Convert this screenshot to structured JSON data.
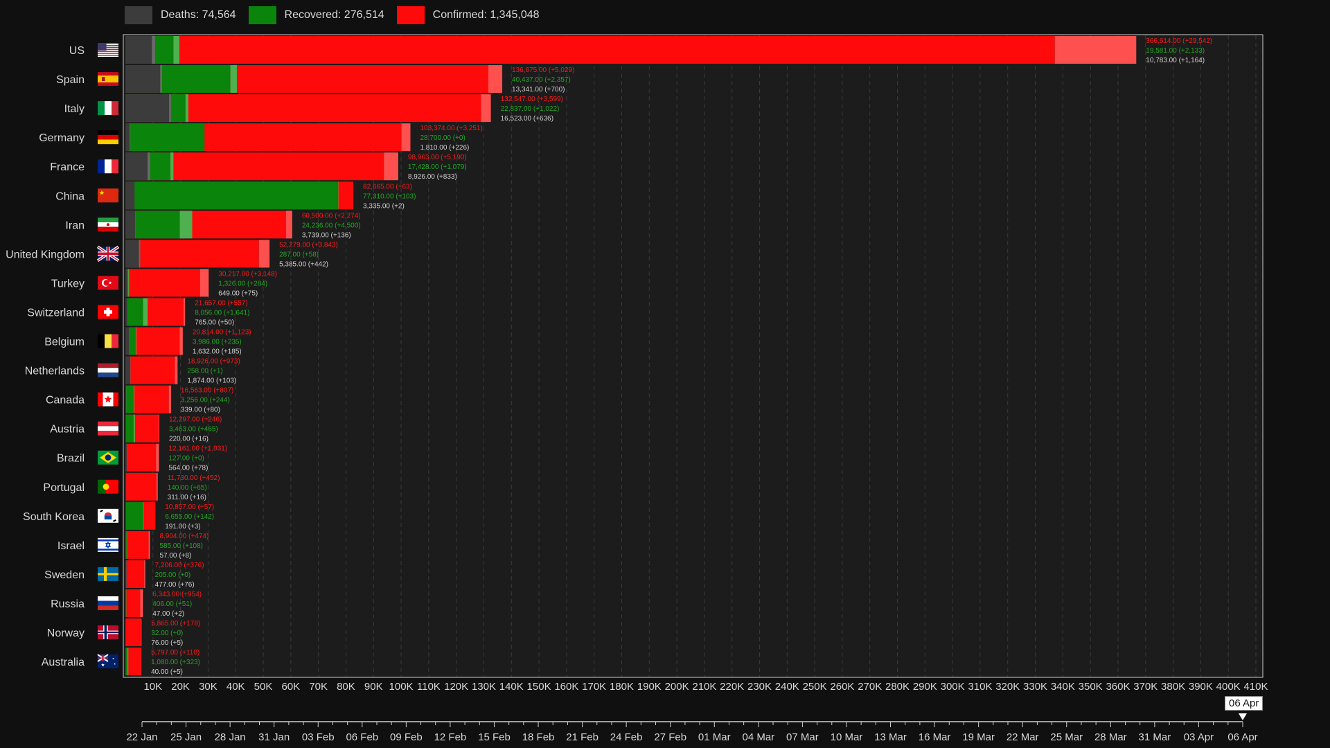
{
  "legend": {
    "deaths_label": "Deaths: 74,564",
    "recovered_label": "Recovered: 276,514",
    "confirmed_label": "Confirmed: 1,345,048"
  },
  "colors": {
    "background": "#101010",
    "deaths": "#3c3c3c",
    "recovered": "#0b840b",
    "confirmed": "#ff0a0a",
    "increment": "#ff5050",
    "plot_bg": "#1c1c1c",
    "text": "#d8d8d8"
  },
  "timeline": {
    "labels": [
      "22 Jan",
      "25 Jan",
      "28 Jan",
      "31 Jan",
      "03 Feb",
      "06 Feb",
      "09 Feb",
      "12 Feb",
      "15 Feb",
      "18 Feb",
      "21 Feb",
      "24 Feb",
      "27 Feb",
      "01 Mar",
      "04 Mar",
      "07 Mar",
      "10 Mar",
      "13 Mar",
      "16 Mar",
      "19 Mar",
      "22 Mar",
      "25 Mar",
      "28 Mar",
      "31 Mar",
      "03 Apr",
      "06 Apr"
    ],
    "current": "06 Apr"
  },
  "chart_data": {
    "type": "bar",
    "orientation": "horizontal",
    "stacked": "overlay",
    "xlim": [
      0,
      410000
    ],
    "x_ticks": [
      "10K",
      "20K",
      "30K",
      "40K",
      "50K",
      "60K",
      "70K",
      "80K",
      "90K",
      "100K",
      "110K",
      "120K",
      "130K",
      "140K",
      "150K",
      "160K",
      "170K",
      "180K",
      "190K",
      "200K",
      "210K",
      "220K",
      "230K",
      "240K",
      "250K",
      "260K",
      "270K",
      "280K",
      "290K",
      "300K",
      "310K",
      "320K",
      "330K",
      "340K",
      "350K",
      "360K",
      "370K",
      "380K",
      "390K",
      "400K",
      "410K"
    ],
    "grid": true,
    "legend_position": "top-left",
    "rows": [
      {
        "country": "US",
        "flag": "us",
        "confirmed": 366614,
        "confirmed_inc": 29542,
        "recovered": 19581,
        "recovered_inc": 2133,
        "deaths": 10783,
        "deaths_inc": 1164,
        "confirmed_label": "366,614.00 (+29,542)",
        "recovered_label": "19,581.00 (+2,133)",
        "deaths_label": "10,783.00 (+1,164)"
      },
      {
        "country": "Spain",
        "flag": "es",
        "confirmed": 136675,
        "confirmed_inc": 5029,
        "recovered": 40437,
        "recovered_inc": 2357,
        "deaths": 13341,
        "deaths_inc": 700,
        "confirmed_label": "136,675.00 (+5,029)",
        "recovered_label": "40,437.00 (+2,357)",
        "deaths_label": "13,341.00 (+700)"
      },
      {
        "country": "Italy",
        "flag": "it",
        "confirmed": 132547,
        "confirmed_inc": 3599,
        "recovered": 22837,
        "recovered_inc": 1022,
        "deaths": 16523,
        "deaths_inc": 636,
        "confirmed_label": "132,547.00 (+3,599)",
        "recovered_label": "22,837.00 (+1,022)",
        "deaths_label": "16,523.00 (+636)"
      },
      {
        "country": "Germany",
        "flag": "de",
        "confirmed": 103374,
        "confirmed_inc": 3251,
        "recovered": 28700,
        "recovered_inc": 0,
        "deaths": 1810,
        "deaths_inc": 226,
        "confirmed_label": "103,374.00 (+3,251)",
        "recovered_label": "28,700.00 (+0)",
        "deaths_label": "1,810.00 (+226)"
      },
      {
        "country": "France",
        "flag": "fr",
        "confirmed": 98963,
        "confirmed_inc": 5190,
        "recovered": 17428,
        "recovered_inc": 1079,
        "deaths": 8926,
        "deaths_inc": 833,
        "confirmed_label": "98,963.00 (+5,190)",
        "recovered_label": "17,428.00 (+1,079)",
        "deaths_label": "8,926.00 (+833)"
      },
      {
        "country": "China",
        "flag": "cn",
        "confirmed": 82665,
        "confirmed_inc": 63,
        "recovered": 77310,
        "recovered_inc": 103,
        "deaths": 3335,
        "deaths_inc": 2,
        "confirmed_label": "82,665.00 (+63)",
        "recovered_label": "77,310.00 (+103)",
        "deaths_label": "3,335.00 (+2)"
      },
      {
        "country": "Iran",
        "flag": "ir",
        "confirmed": 60500,
        "confirmed_inc": 2274,
        "recovered": 24236,
        "recovered_inc": 4500,
        "deaths": 3739,
        "deaths_inc": 136,
        "confirmed_label": "60,500.00 (+2,274)",
        "recovered_label": "24,236.00 (+4,500)",
        "deaths_label": "3,739.00 (+136)"
      },
      {
        "country": "United Kingdom",
        "flag": "gb",
        "confirmed": 52279,
        "confirmed_inc": 3843,
        "recovered": 287,
        "recovered_inc": 58,
        "deaths": 5385,
        "deaths_inc": 442,
        "confirmed_label": "52,279.00 (+3,843)",
        "recovered_label": "287.00 (+58)",
        "deaths_label": "5,385.00 (+442)"
      },
      {
        "country": "Turkey",
        "flag": "tr",
        "confirmed": 30217,
        "confirmed_inc": 3148,
        "recovered": 1326,
        "recovered_inc": 284,
        "deaths": 649,
        "deaths_inc": 75,
        "confirmed_label": "30,217.00 (+3,148)",
        "recovered_label": "1,326.00 (+284)",
        "deaths_label": "649.00 (+75)"
      },
      {
        "country": "Switzerland",
        "flag": "ch",
        "confirmed": 21657,
        "confirmed_inc": 557,
        "recovered": 8056,
        "recovered_inc": 1641,
        "deaths": 765,
        "deaths_inc": 50,
        "confirmed_label": "21,657.00 (+557)",
        "recovered_label": "8,056.00 (+1,641)",
        "deaths_label": "765.00 (+50)"
      },
      {
        "country": "Belgium",
        "flag": "be",
        "confirmed": 20814,
        "confirmed_inc": 1123,
        "recovered": 3986,
        "recovered_inc": 235,
        "deaths": 1632,
        "deaths_inc": 185,
        "confirmed_label": "20,814.00 (+1,123)",
        "recovered_label": "3,986.00 (+235)",
        "deaths_label": "1,632.00 (+185)"
      },
      {
        "country": "Netherlands",
        "flag": "nl",
        "confirmed": 18926,
        "confirmed_inc": 973,
        "recovered": 258,
        "recovered_inc": 1,
        "deaths": 1874,
        "deaths_inc": 103,
        "confirmed_label": "18,926.00 (+973)",
        "recovered_label": "258.00 (+1)",
        "deaths_label": "1,874.00 (+103)"
      },
      {
        "country": "Canada",
        "flag": "ca",
        "confirmed": 16563,
        "confirmed_inc": 807,
        "recovered": 3256,
        "recovered_inc": 244,
        "deaths": 339,
        "deaths_inc": 80,
        "confirmed_label": "16,563.00 (+807)",
        "recovered_label": "3,256.00 (+244)",
        "deaths_label": "339.00 (+80)"
      },
      {
        "country": "Austria",
        "flag": "at",
        "confirmed": 12297,
        "confirmed_inc": 246,
        "recovered": 3463,
        "recovered_inc": 465,
        "deaths": 220,
        "deaths_inc": 16,
        "confirmed_label": "12,297.00 (+246)",
        "recovered_label": "3,463.00 (+465)",
        "deaths_label": "220.00 (+16)"
      },
      {
        "country": "Brazil",
        "flag": "br",
        "confirmed": 12161,
        "confirmed_inc": 1031,
        "recovered": 127,
        "recovered_inc": 0,
        "deaths": 564,
        "deaths_inc": 78,
        "confirmed_label": "12,161.00 (+1,031)",
        "recovered_label": "127.00 (+0)",
        "deaths_label": "564.00 (+78)"
      },
      {
        "country": "Portugal",
        "flag": "pt",
        "confirmed": 11730,
        "confirmed_inc": 452,
        "recovered": 140,
        "recovered_inc": 65,
        "deaths": 311,
        "deaths_inc": 16,
        "confirmed_label": "11,730.00 (+452)",
        "recovered_label": "140.00 (+65)",
        "deaths_label": "311.00 (+16)"
      },
      {
        "country": "South Korea",
        "flag": "kr",
        "confirmed": 10857,
        "confirmed_inc": 57,
        "recovered": 6655,
        "recovered_inc": 142,
        "deaths": 191,
        "deaths_inc": 3,
        "confirmed_label": "10,857.00 (+57)",
        "recovered_label": "6,655.00 (+142)",
        "deaths_label": "191.00 (+3)"
      },
      {
        "country": "Israel",
        "flag": "il",
        "confirmed": 8904,
        "confirmed_inc": 474,
        "recovered": 585,
        "recovered_inc": 108,
        "deaths": 57,
        "deaths_inc": 8,
        "confirmed_label": "8,904.00 (+474)",
        "recovered_label": "585.00 (+108)",
        "deaths_label": "57.00 (+8)"
      },
      {
        "country": "Sweden",
        "flag": "se",
        "confirmed": 7206,
        "confirmed_inc": 376,
        "recovered": 205,
        "recovered_inc": 0,
        "deaths": 477,
        "deaths_inc": 76,
        "confirmed_label": "7,206.00 (+376)",
        "recovered_label": "205.00 (+0)",
        "deaths_label": "477.00 (+76)"
      },
      {
        "country": "Russia",
        "flag": "ru",
        "confirmed": 6343,
        "confirmed_inc": 954,
        "recovered": 406,
        "recovered_inc": 51,
        "deaths": 47,
        "deaths_inc": 2,
        "confirmed_label": "6,343.00 (+954)",
        "recovered_label": "406.00 (+51)",
        "deaths_label": "47.00 (+2)"
      },
      {
        "country": "Norway",
        "flag": "no",
        "confirmed": 5865,
        "confirmed_inc": 178,
        "recovered": 32,
        "recovered_inc": 0,
        "deaths": 76,
        "deaths_inc": 5,
        "confirmed_label": "5,865.00 (+178)",
        "recovered_label": "32.00 (+0)",
        "deaths_label": "76.00 (+5)"
      },
      {
        "country": "Australia",
        "flag": "au",
        "confirmed": 5797,
        "confirmed_inc": 110,
        "recovered": 1080,
        "recovered_inc": 323,
        "deaths": 40,
        "deaths_inc": 5,
        "confirmed_label": "5,797.00 (+110)",
        "recovered_label": "1,080.00 (+323)",
        "deaths_label": "40.00 (+5)"
      }
    ]
  }
}
